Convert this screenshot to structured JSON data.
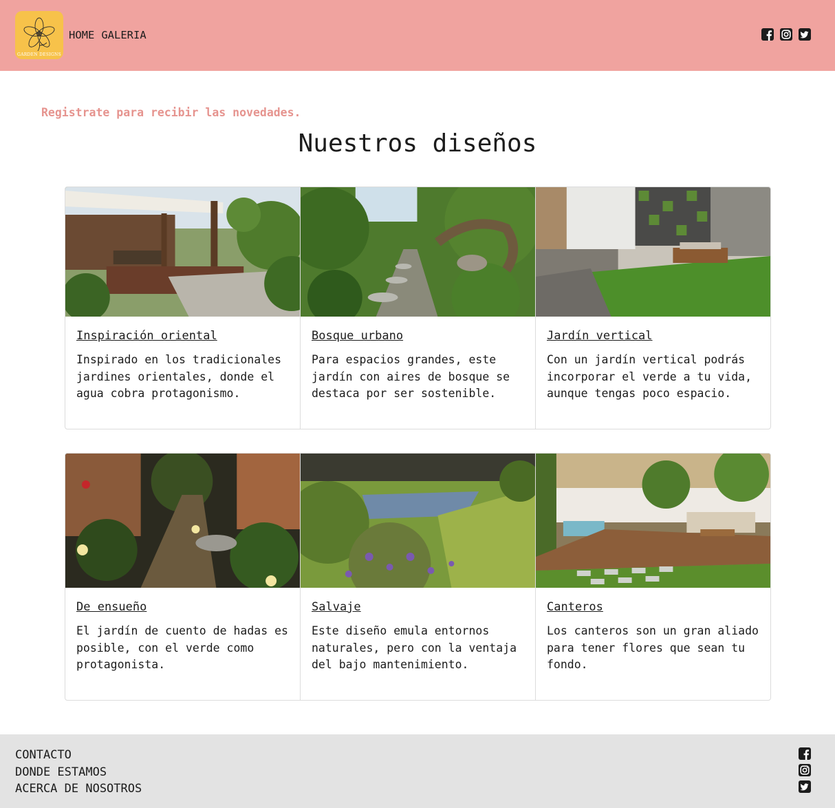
{
  "header": {
    "logo_text": "GARDEN DESIGNS",
    "nav": [
      {
        "label": "HOME"
      },
      {
        "label": "GALERIA"
      }
    ],
    "social": [
      "facebook-icon",
      "instagram-icon",
      "twitter-icon"
    ],
    "background_color": "#f0a39f"
  },
  "main": {
    "register_text": "Registrate para recibir las novedades.",
    "title": "Nuestros diseños",
    "cards": [
      {
        "title": "Inspiración oriental",
        "text": "Inspirado en los tradicionales jardines orientales, donde el agua cobra protagonismo."
      },
      {
        "title": "Bosque urbano",
        "text": "Para espacios grandes, este jardín con aires de bosque se destaca por ser sostenible."
      },
      {
        "title": "Jardín vertical",
        "text": "Con un jardín vertical podrás incorporar el verde a tu vida, aunque tengas poco espacio."
      },
      {
        "title": "De ensueño",
        "text": "El jardín de cuento de hadas es posible, con el verde como protagonista."
      },
      {
        "title": "Salvaje",
        "text": "Este diseño emula entornos naturales, pero con la ventaja del bajo mantenimiento."
      },
      {
        "title": "Canteros",
        "text": "Los canteros son un gran aliado para tener flores que sean tu fondo."
      }
    ]
  },
  "footer": {
    "links": [
      {
        "label": "CONTACTO"
      },
      {
        "label": "DONDE ESTAMOS"
      },
      {
        "label": "ACERCA DE NOSOTROS"
      }
    ],
    "social": [
      "facebook-icon",
      "instagram-icon",
      "twitter-icon"
    ],
    "background_color": "#e3e3e3"
  }
}
